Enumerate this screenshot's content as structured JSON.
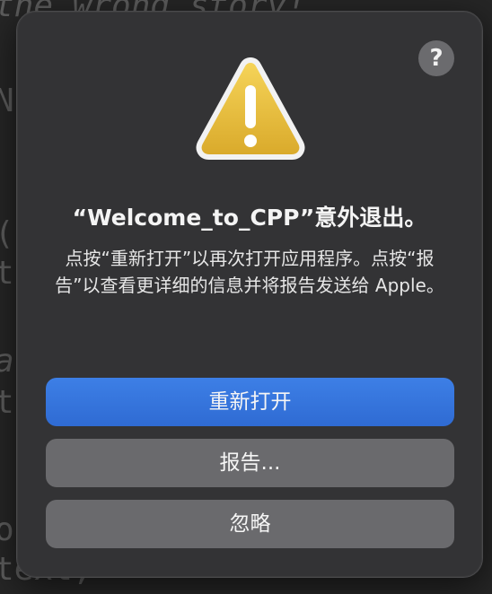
{
  "background": {
    "code_lines": [
      "the wrong story!",
      "N",
      "(",
      "t",
      "a",
      "t",
      "o(",
      "text,"
    ]
  },
  "dialog": {
    "help_label": "?",
    "icon": "warning-icon",
    "title": "“Welcome_to_CPP”意外退出。",
    "message": "点按“重新打开”以再次打开应用程序。点按“报告”以查看更详细的信息并将报告发送给 Apple。",
    "buttons": {
      "reopen": "重新打开",
      "report": "报告...",
      "ignore": "忽略"
    }
  },
  "colors": {
    "primary_button": "#2f6bd3",
    "secondary_button": "#6a6a6d",
    "dialog_bg": "#333335",
    "warning_yellow": "#e6b93a"
  }
}
